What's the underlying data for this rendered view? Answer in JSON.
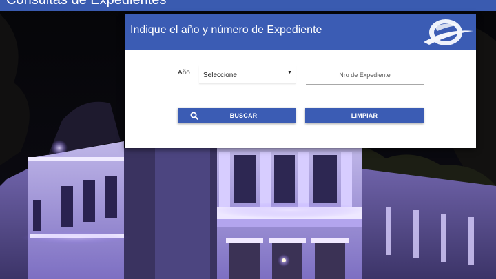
{
  "page": {
    "header_title": "Consultas de Expedientes"
  },
  "form": {
    "title": "Indique el año y número de Expediente",
    "logo_icon": "blue-swoosh-logo-icon",
    "year_label": "Año",
    "year_selected": "Seleccione",
    "expediente_placeholder": "Nro de Expediente",
    "search_label": "BUSCAR",
    "search_icon": "search-icon",
    "clear_label": "LIMPIAR"
  },
  "colors": {
    "primary": "#3b5cb4",
    "topbar": "#3a5bb0",
    "card_bg": "#ffffff",
    "building_light": "#b9a7f2"
  }
}
